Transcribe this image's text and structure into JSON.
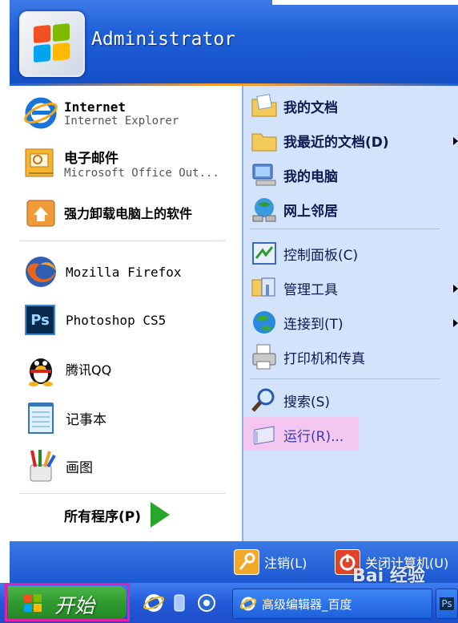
{
  "user": {
    "name": "Administrator"
  },
  "left_items": [
    {
      "title": "Internet",
      "subtitle": "Internet Explorer",
      "icon": "ie-icon"
    },
    {
      "title": "电子邮件",
      "subtitle": "Microsoft Office Out...",
      "icon": "outlook-icon"
    },
    {
      "title": "强力卸载电脑上的软件",
      "icon": "uninstall-icon"
    },
    {
      "title": "Mozilla Firefox",
      "icon": "firefox-icon"
    },
    {
      "title": "Photoshop CS5",
      "icon": "photoshop-icon"
    },
    {
      "title": "腾讯QQ",
      "icon": "qq-icon"
    },
    {
      "title": "记事本",
      "icon": "notepad-icon"
    },
    {
      "title": "画图",
      "icon": "paint-icon"
    }
  ],
  "all_programs": "所有程序(P)",
  "right_items": [
    {
      "label": "我的文档",
      "icon": "my-documents-icon"
    },
    {
      "label": "我最近的文档(D)",
      "icon": "recent-docs-icon"
    },
    {
      "label": "我的电脑",
      "icon": "my-computer-icon"
    },
    {
      "label": "网上邻居",
      "icon": "network-icon"
    },
    {
      "label": "控制面板(C)",
      "icon": "control-panel-icon"
    },
    {
      "label": "管理工具",
      "icon": "admin-tools-icon"
    },
    {
      "label": "连接到(T)",
      "icon": "connect-icon"
    },
    {
      "label": "打印机和传真",
      "icon": "printer-icon"
    },
    {
      "label": "搜索(S)",
      "icon": "search-icon"
    },
    {
      "label": "运行(R)...",
      "icon": "run-icon"
    }
  ],
  "footer": {
    "logoff": "注销(L)",
    "shutdown": "关闭计算机(U)"
  },
  "taskbar": {
    "start": "开始",
    "task1": "高级编辑器_百度",
    "watermark": "Bai 经验"
  },
  "colors": {
    "highlight": "#f3c7ef",
    "start_frame": "#e61fa8"
  }
}
